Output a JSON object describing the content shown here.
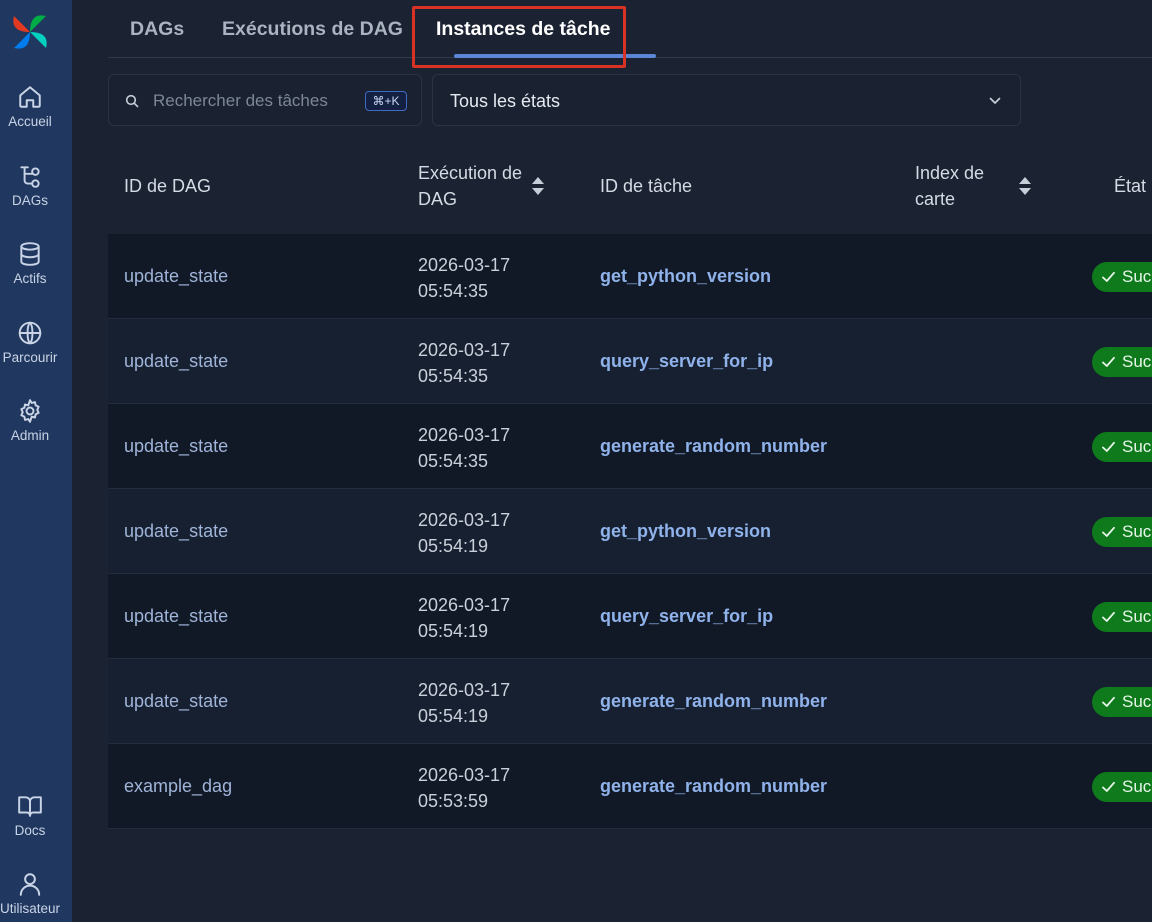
{
  "sidebar": {
    "items": [
      {
        "label": "Accueil",
        "icon": "home-icon"
      },
      {
        "label": "DAGs",
        "icon": "dags-icon"
      },
      {
        "label": "Actifs",
        "icon": "database-icon"
      },
      {
        "label": "Parcourir",
        "icon": "globe-icon"
      },
      {
        "label": "Admin",
        "icon": "gear-icon"
      }
    ],
    "bottom_items": [
      {
        "label": "Docs",
        "icon": "book-icon"
      },
      {
        "label": "Utilisateur",
        "icon": "user-icon"
      }
    ]
  },
  "tabs": [
    {
      "label": "DAGs",
      "active": false
    },
    {
      "label": "Exécutions de DAG",
      "active": false
    },
    {
      "label": "Instances de tâche",
      "active": true
    }
  ],
  "filters": {
    "search_placeholder": "Rechercher des tâches",
    "search_value": "",
    "shortcut": "⌘+K",
    "state_select": "Tous les états"
  },
  "table": {
    "headers": {
      "dag_id": "ID de DAG",
      "dag_run_line1": "Exécution de",
      "dag_run_line2": "DAG",
      "task_id": "ID de tâche",
      "map_index_line1": "Index de",
      "map_index_line2": "carte",
      "state": "État"
    },
    "rows": [
      {
        "dag_id": "update_state",
        "date": "2026-03-17",
        "time": "05:54:35",
        "task_id": "get_python_version",
        "state": "Succès"
      },
      {
        "dag_id": "update_state",
        "date": "2026-03-17",
        "time": "05:54:35",
        "task_id": "query_server_for_ip",
        "state": "Succès"
      },
      {
        "dag_id": "update_state",
        "date": "2026-03-17",
        "time": "05:54:35",
        "task_id": "generate_random_number",
        "state": "Succès"
      },
      {
        "dag_id": "update_state",
        "date": "2026-03-17",
        "time": "05:54:19",
        "task_id": "get_python_version",
        "state": "Succès"
      },
      {
        "dag_id": "update_state",
        "date": "2026-03-17",
        "time": "05:54:19",
        "task_id": "query_server_for_ip",
        "state": "Succès"
      },
      {
        "dag_id": "update_state",
        "date": "2026-03-17",
        "time": "05:54:19",
        "task_id": "generate_random_number",
        "state": "Succès"
      },
      {
        "dag_id": "example_dag",
        "date": "2026-03-17",
        "time": "05:53:59",
        "task_id": "generate_random_number",
        "state": "Succès"
      }
    ]
  },
  "colors": {
    "sidebar_bg": "#20375f",
    "page_bg": "#1b2232",
    "accent": "#5b86d6",
    "success": "#0f7a1c",
    "highlight": "#d83224"
  }
}
